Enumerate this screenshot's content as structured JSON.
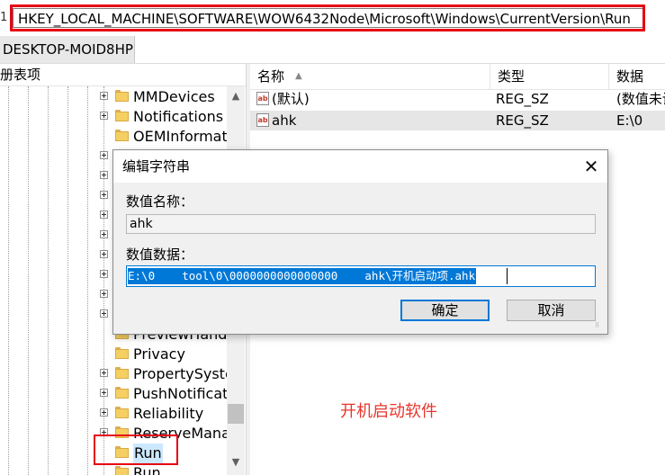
{
  "address_bar": {
    "prefix": "1",
    "path": "HKEY_LOCAL_MACHINE\\SOFTWARE\\WOW6432Node\\Microsoft\\Windows\\CurrentVersion\\Run"
  },
  "tab": {
    "label": "DESKTOP-MOID8HP"
  },
  "tree": {
    "header": "册表项",
    "items": [
      {
        "label": "MMDevices",
        "expandable": true
      },
      {
        "label": "Notifications",
        "expandable": true
      },
      {
        "label": "OEMInformati",
        "expandable": false
      },
      {
        "label": "",
        "expandable": true
      },
      {
        "label": "",
        "expandable": true
      },
      {
        "label": "",
        "expandable": true
      },
      {
        "label": "",
        "expandable": true
      },
      {
        "label": "",
        "expandable": true
      },
      {
        "label": "",
        "expandable": true
      },
      {
        "label": "",
        "expandable": true
      },
      {
        "label": "",
        "expandable": true
      },
      {
        "label": "",
        "expandable": true
      },
      {
        "label": "PreviewHandle",
        "expandable": false
      },
      {
        "label": "Privacy",
        "expandable": false
      },
      {
        "label": "PropertySyste",
        "expandable": true
      },
      {
        "label": "PushNotificati",
        "expandable": true
      },
      {
        "label": "Reliability",
        "expandable": true
      },
      {
        "label": "ReserveManag",
        "expandable": true
      },
      {
        "label": "Run",
        "expandable": false,
        "selected": true
      },
      {
        "label": "Run",
        "expandable": false
      }
    ]
  },
  "list": {
    "columns": [
      "名称",
      "类型",
      "数据"
    ],
    "rows": [
      {
        "name": "(默认)",
        "type": "REG_SZ",
        "data": "(数值未设"
      },
      {
        "name": "ahk",
        "type": "REG_SZ",
        "data": "E:\\0"
      }
    ]
  },
  "dialog": {
    "title": "编辑字符串",
    "value_name_label": "数值名称：",
    "value_name": "ahk",
    "value_data_label": "数值数据：",
    "value_data": "E:\\0    tool\\0\\0000000000000000    ahk\\开机启动项.ahk",
    "ok_label": "确定",
    "cancel_label": "取消"
  },
  "annotation": {
    "caption": "开机启动软件",
    "color": "#e60012"
  },
  "icons": {
    "folder": "folder-icon",
    "string_value": "string-value-icon",
    "close": "close-icon",
    "expand": "expand-plus-icon"
  }
}
